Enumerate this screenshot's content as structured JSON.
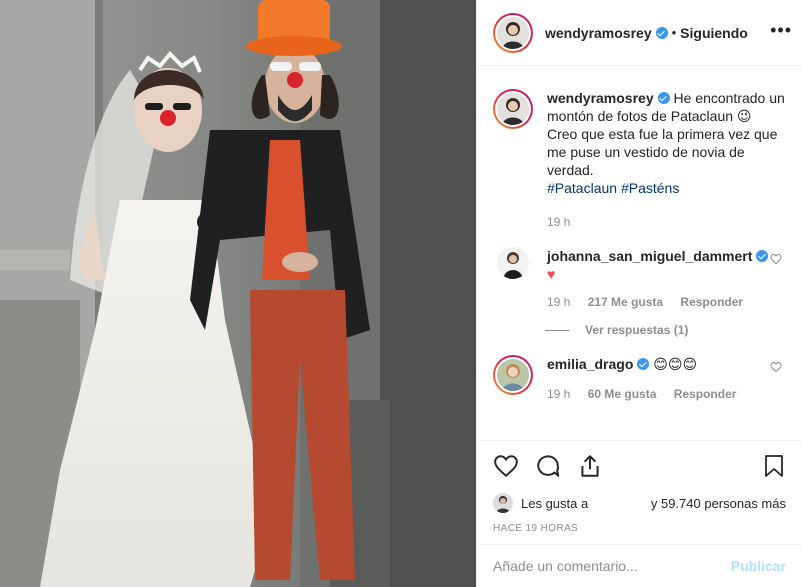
{
  "post": {
    "username": "wendyramosrey",
    "follow_status": "Siguiendo",
    "separator": "•",
    "more_label": "•••",
    "caption_lines": [
      "He encontrado un",
      "montón de fotos de Pataclaun 😉",
      "Creo que esta fue la primera vez que",
      "me puse un vestido de novia de",
      "verdad."
    ],
    "hashtags": "#Pataclaun #Pasténs",
    "caption_time": "19 h"
  },
  "comments": [
    {
      "username": "johanna_san_miguel_dammert",
      "text": "♥",
      "time": "19 h",
      "likes": "217 Me gusta",
      "reply": "Responder",
      "view_replies": "Ver respuestas (1)"
    },
    {
      "username": "emilia_drago",
      "text": "😊😊😊",
      "time": "19 h",
      "likes": "60 Me gusta",
      "reply": "Responder"
    }
  ],
  "actions": {
    "liked_by_prefix": "Les gusta a",
    "liked_by_suffix": "y 59.740 personas más",
    "posted_time": "HACE 19 HORAS",
    "icons": [
      "heart-icon",
      "comment-icon",
      "share-icon",
      "bookmark-icon"
    ]
  },
  "add_comment": {
    "placeholder": "Añade un comentario...",
    "publish_label": "Publicar"
  },
  "colors": {
    "verified": "#3897f0",
    "hashtag": "#00376b",
    "secondary_text": "#8e8e8e",
    "publish_disabled": "#b2dffc",
    "heart_red": "#ed4956"
  }
}
